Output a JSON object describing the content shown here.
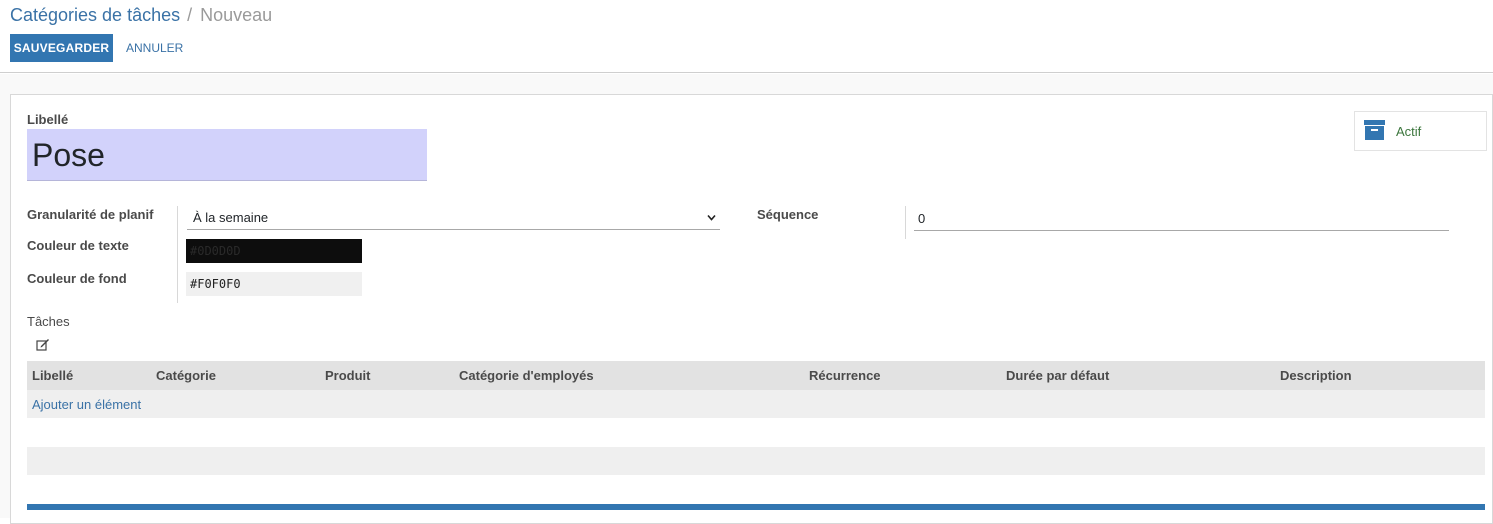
{
  "breadcrumb": {
    "parent": "Catégories de tâches",
    "separator": "/",
    "current": "Nouveau"
  },
  "toolbar": {
    "save_label": "SAUVEGARDER",
    "cancel_label": "ANNULER"
  },
  "form": {
    "name_label": "Libellé",
    "name_value": "Pose",
    "active_button": "Actif",
    "granularity_label": "Granularité de planif",
    "granularity_value": "À la semaine",
    "sequence_label": "Séquence",
    "sequence_value": "0",
    "text_color_label": "Couleur de texte",
    "text_color_value": "#0D0D0D",
    "bg_color_label": "Couleur de fond",
    "bg_color_value": "#F0F0F0"
  },
  "tasks": {
    "label": "Tâches",
    "columns": [
      "Libellé",
      "Catégorie",
      "Produit",
      "Catégorie d'employés",
      "Récurrence",
      "Durée par défaut",
      "Description"
    ],
    "add_item": "Ajouter un élément"
  },
  "colors": {
    "accent": "#3276b1",
    "link": "#3a72a6",
    "required_field": "#d2d2fb",
    "active_text": "#3c763d"
  },
  "icons": {
    "archive": "archive-icon",
    "edit": "edit-icon",
    "dropdown": "chevron-down-icon"
  }
}
